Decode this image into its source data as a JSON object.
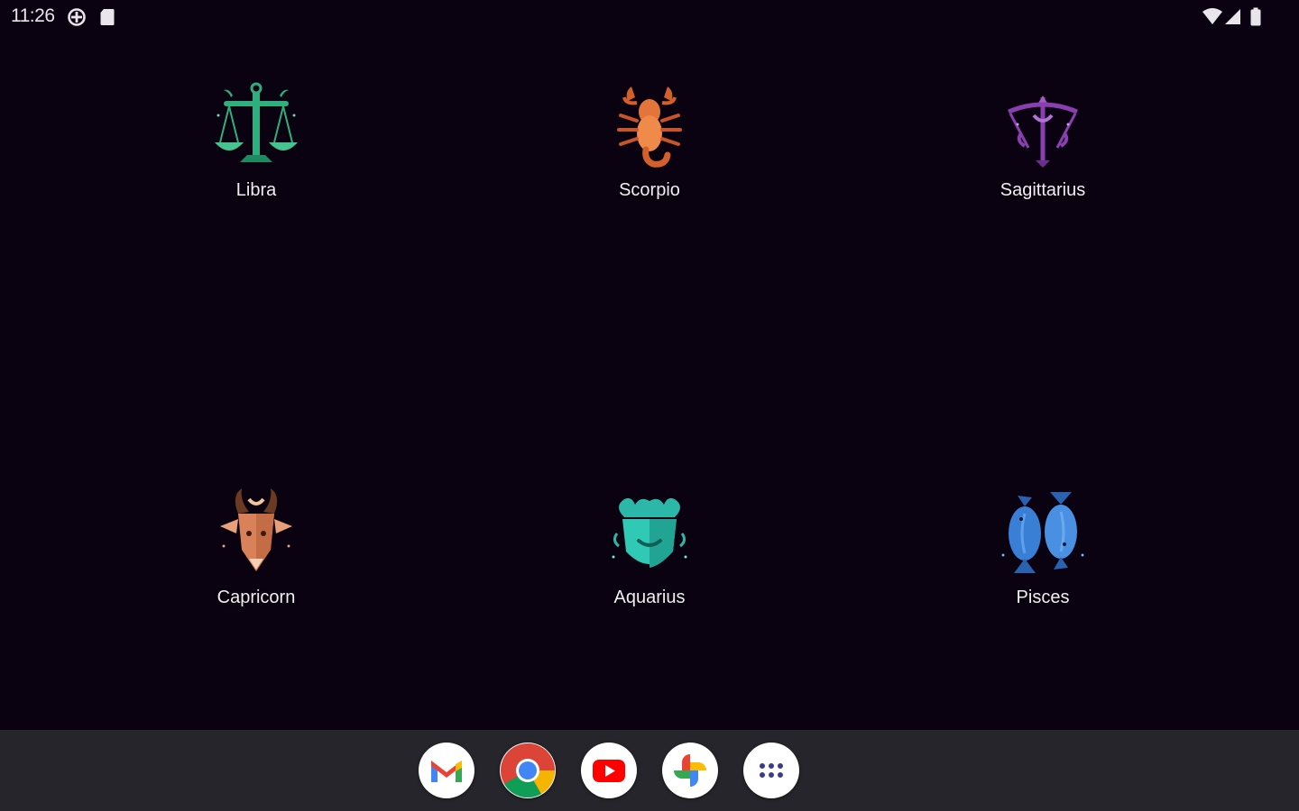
{
  "status_bar": {
    "time": "11:26",
    "left_icons": [
      "data-saver-icon",
      "sd-card-icon"
    ],
    "right_icons": [
      "wifi-icon",
      "cell-signal-icon",
      "battery-icon"
    ]
  },
  "apps": [
    {
      "label": "Libra",
      "icon": "libra-scales-icon",
      "color": "#2fae7e"
    },
    {
      "label": "Scorpio",
      "icon": "scorpio-scorpion-icon",
      "color": "#e3743a"
    },
    {
      "label": "Sagittarius",
      "icon": "sagittarius-bow-icon",
      "color": "#8a3fb0"
    },
    {
      "label": "Capricorn",
      "icon": "capricorn-goat-icon",
      "color": "#d9825a"
    },
    {
      "label": "Aquarius",
      "icon": "aquarius-icon",
      "color": "#2bb8a8"
    },
    {
      "label": "Pisces",
      "icon": "pisces-fish-icon",
      "color": "#3a7fd6"
    }
  ],
  "dock": {
    "apps": [
      "gmail-icon",
      "chrome-icon",
      "youtube-icon",
      "photos-icon",
      "app-drawer-icon"
    ]
  },
  "colors": {
    "background": "#0a0210",
    "dock": "#26252b",
    "label": "#f1eef4"
  }
}
